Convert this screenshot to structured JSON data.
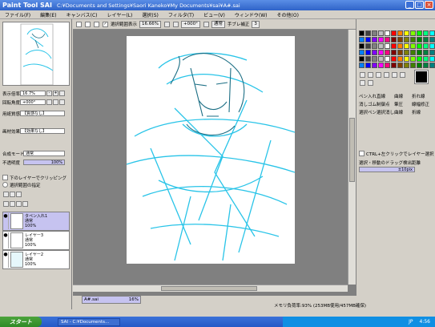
{
  "window": {
    "logo": "Paint Tool SAI",
    "title": "C:¥Documents and Settings¥Saori Kaneko¥My Documents¥sai¥A#.sai"
  },
  "menu": [
    "ファイル(F)",
    "編集(E)",
    "キャンバス(C)",
    "レイヤー(L)",
    "選択(S)",
    "フィルタ(T)",
    "ビュー(V)",
    "ウィンドウ(W)",
    "その他(O)"
  ],
  "left": {
    "zoom_label": "表示倍率",
    "zoom_value": "16.7%",
    "rotate_label": "回転角度",
    "rotate_value": "+000°",
    "texture_label": "用紙質感",
    "texture_value": "【質感なし】",
    "effect_label": "画材効果",
    "effect_value": "【効果なし】",
    "blend_label": "合成モード",
    "blend_value": "通常",
    "opacity_label": "不透明度",
    "opacity_value": "100%",
    "options": [
      "下のレイヤーでクリッピング",
      "選択範囲の指定"
    ],
    "layers": [
      {
        "name": "タペン入れ1",
        "mode": "通常",
        "opacity": "100%"
      },
      {
        "name": "レイヤー3",
        "mode": "通常",
        "opacity": "100%"
      },
      {
        "name": "レイヤー2",
        "mode": "通常",
        "opacity": "100%"
      }
    ]
  },
  "toolbar": {
    "selection": "選択範囲表示",
    "zoom": "16.66%",
    "angle": "+000°",
    "mode": "通常",
    "stab_label": "手ブレ補正",
    "stab_value": "3"
  },
  "right": {
    "tools": [
      "ペン入れ",
      "直線",
      "曲線",
      "折れ線",
      "消しゴム",
      "制御点",
      "筆圧",
      "線幅修正",
      "選択ペン",
      "選択消し",
      "曲線",
      "折線"
    ],
    "ctrl_option": "CTRL+左クリックでレイヤー選択",
    "drag_label": "選択・移動のドラッグ検出距離",
    "drag_value": "±10pix"
  },
  "file_tab": {
    "name": "A#.sai",
    "zoom": "16%"
  },
  "status": "メモリ負荷率:93% (253MB使用/457MB確保)",
  "taskbar": {
    "start": "スタート",
    "task": "SAI - C:¥Documents...",
    "clock": "4:56",
    "ime": "JP"
  },
  "colors": {
    "accent": "#2f63c8",
    "sketch": "#29c4e8",
    "ink": "#1b6e84"
  }
}
